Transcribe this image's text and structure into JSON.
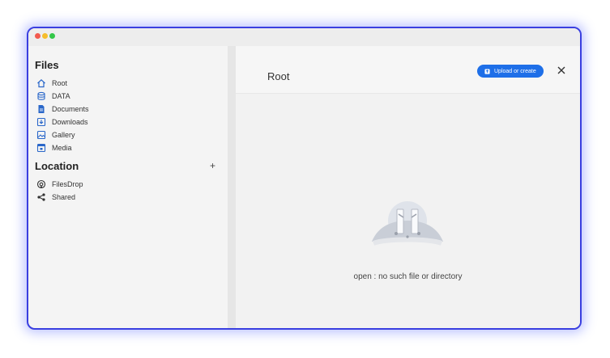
{
  "sidebar": {
    "files_title": "Files",
    "location_title": "Location",
    "add_label": "+",
    "files": [
      {
        "label": "Root",
        "icon": "home-icon"
      },
      {
        "label": "DATA",
        "icon": "database-icon"
      },
      {
        "label": "Documents",
        "icon": "document-icon"
      },
      {
        "label": "Downloads",
        "icon": "download-icon"
      },
      {
        "label": "Gallery",
        "icon": "image-icon"
      },
      {
        "label": "Media",
        "icon": "media-icon"
      }
    ],
    "locations": [
      {
        "label": "FilesDrop",
        "icon": "filesdrop-icon"
      },
      {
        "label": "Shared",
        "icon": "share-icon"
      }
    ]
  },
  "main": {
    "title": "Root",
    "upload_label": "Upload or create",
    "close_label": "close-icon",
    "error_text": "open : no such file or directory"
  },
  "colors": {
    "accent": "#1e6fe8",
    "icon": "#2a67c9",
    "window_border": "#3a3fe0"
  }
}
